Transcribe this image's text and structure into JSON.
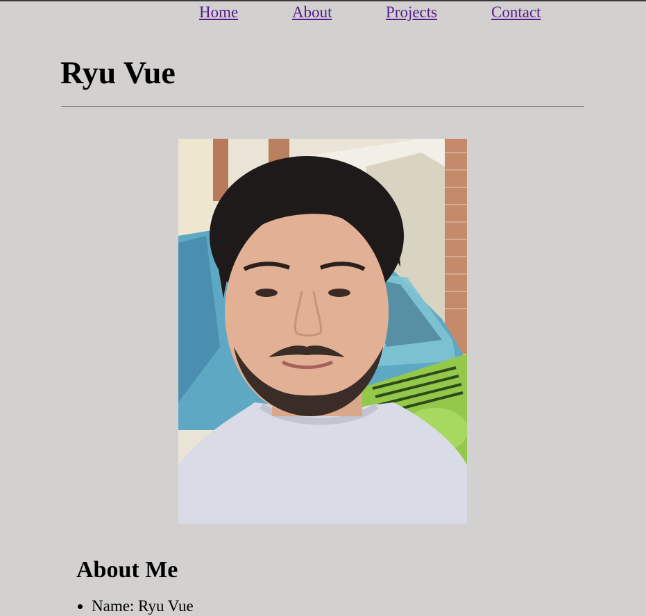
{
  "nav": {
    "home": "Home",
    "about": "About",
    "projects": "Projects",
    "contact": "Contact"
  },
  "header": {
    "title": "Ryu Vue"
  },
  "profile_photo": {
    "description_icon": "portrait-photo"
  },
  "about": {
    "heading": "About Me",
    "items": [
      {
        "label": "Name: Ryu Vue"
      }
    ]
  },
  "colors": {
    "background": "#d3d1d0",
    "link": "#551a8b"
  }
}
